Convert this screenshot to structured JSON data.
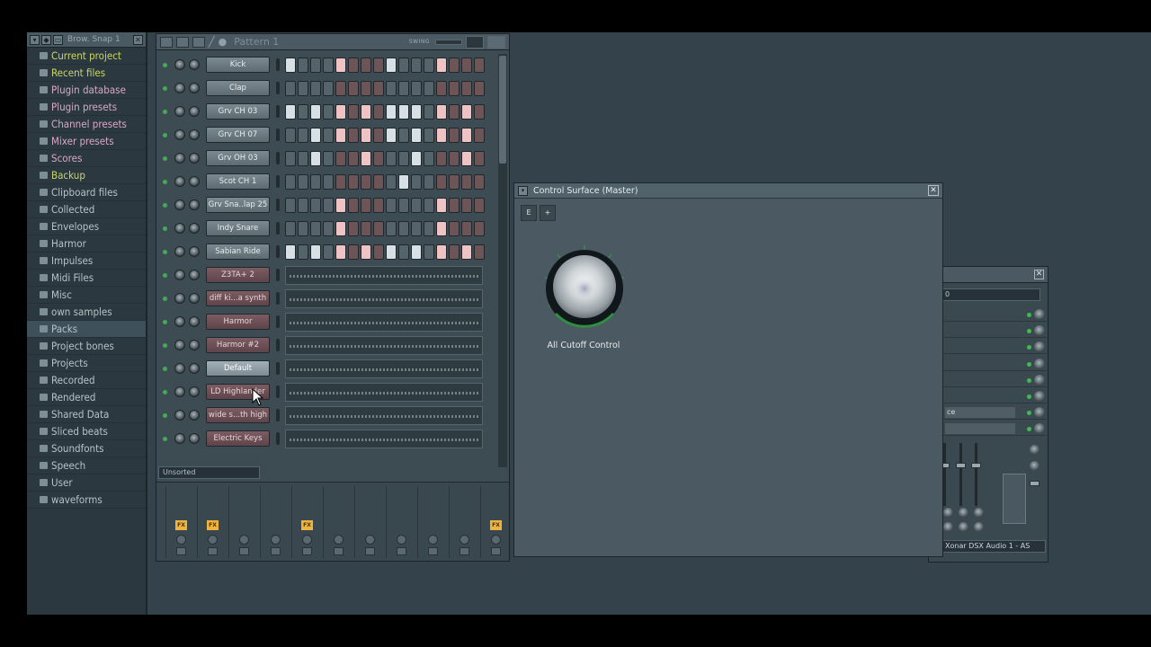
{
  "browser": {
    "title": "Brow. Snap 1",
    "items": [
      {
        "label": "Current project",
        "style": "hl",
        "icon": "project-icon"
      },
      {
        "label": "Recent files",
        "style": "hl",
        "icon": "recent-icon"
      },
      {
        "label": "Plugin database",
        "style": "pk",
        "icon": "plugin-icon"
      },
      {
        "label": "Plugin presets",
        "style": "pk",
        "icon": "plugin-icon"
      },
      {
        "label": "Channel presets",
        "style": "pk",
        "icon": "channel-icon"
      },
      {
        "label": "Mixer presets",
        "style": "pk",
        "icon": "mixer-icon"
      },
      {
        "label": "Scores",
        "style": "pk",
        "icon": "score-icon"
      },
      {
        "label": "Backup",
        "style": "hl",
        "icon": "folder-icon"
      },
      {
        "label": "Clipboard files",
        "style": "nm",
        "icon": "folder-icon"
      },
      {
        "label": "Collected",
        "style": "nm",
        "icon": "folder-icon"
      },
      {
        "label": "Envelopes",
        "style": "nm",
        "icon": "folder-icon"
      },
      {
        "label": "Harmor",
        "style": "nm",
        "icon": "folder-icon"
      },
      {
        "label": "Impulses",
        "style": "nm",
        "icon": "folder-icon"
      },
      {
        "label": "Midi Files",
        "style": "nm",
        "icon": "folder-icon"
      },
      {
        "label": "Misc",
        "style": "nm",
        "icon": "folder-icon"
      },
      {
        "label": "own samples",
        "style": "nm",
        "icon": "folder-icon"
      },
      {
        "label": "Packs",
        "style": "nm sel",
        "icon": "folder-icon"
      },
      {
        "label": "Project bones",
        "style": "nm",
        "icon": "folder-icon"
      },
      {
        "label": "Projects",
        "style": "nm",
        "icon": "folder-icon"
      },
      {
        "label": "Recorded",
        "style": "nm",
        "icon": "folder-icon"
      },
      {
        "label": "Rendered",
        "style": "nm",
        "icon": "folder-icon"
      },
      {
        "label": "Shared Data",
        "style": "nm",
        "icon": "folder-icon"
      },
      {
        "label": "Sliced beats",
        "style": "nm",
        "icon": "folder-icon"
      },
      {
        "label": "Soundfonts",
        "style": "nm",
        "icon": "folder-icon"
      },
      {
        "label": "Speech",
        "style": "nm",
        "icon": "folder-icon"
      },
      {
        "label": "User",
        "style": "nm",
        "icon": "user-icon"
      },
      {
        "label": "waveforms",
        "style": "nm",
        "icon": "folder-icon"
      }
    ]
  },
  "rack": {
    "pattern": "Pattern 1",
    "swing_label": "SWING",
    "filter": "Unsorted",
    "channels": [
      {
        "name": "Kick",
        "kind": "steps",
        "style": "samp",
        "steps": [
          1,
          0,
          0,
          0,
          1,
          0,
          0,
          0,
          1,
          0,
          0,
          0,
          1,
          0,
          0,
          0
        ]
      },
      {
        "name": "Clap",
        "kind": "steps",
        "style": "samp",
        "steps": [
          0,
          0,
          0,
          0,
          0,
          0,
          0,
          0,
          0,
          0,
          0,
          0,
          0,
          0,
          0,
          0
        ]
      },
      {
        "name": "Grv CH 03",
        "kind": "steps",
        "style": "samp",
        "steps": [
          1,
          0,
          1,
          0,
          1,
          0,
          1,
          0,
          1,
          1,
          1,
          0,
          1,
          0,
          1,
          0
        ]
      },
      {
        "name": "Grv CH 07",
        "kind": "steps",
        "style": "samp",
        "steps": [
          0,
          0,
          1,
          0,
          1,
          0,
          1,
          0,
          1,
          0,
          1,
          0,
          1,
          0,
          1,
          0
        ]
      },
      {
        "name": "Grv OH 03",
        "kind": "steps",
        "style": "samp",
        "steps": [
          0,
          0,
          1,
          0,
          0,
          0,
          1,
          0,
          0,
          0,
          1,
          0,
          0,
          0,
          1,
          0
        ]
      },
      {
        "name": "Scot CH 1",
        "kind": "steps",
        "style": "samp",
        "steps": [
          0,
          0,
          0,
          0,
          0,
          0,
          0,
          0,
          0,
          1,
          0,
          0,
          0,
          0,
          0,
          0
        ]
      },
      {
        "name": "Grv Sna..lap 25",
        "kind": "steps",
        "style": "samp",
        "steps": [
          0,
          0,
          0,
          0,
          1,
          0,
          0,
          0,
          0,
          0,
          0,
          0,
          1,
          0,
          0,
          0
        ]
      },
      {
        "name": "Indy Snare",
        "kind": "steps",
        "style": "samp",
        "steps": [
          0,
          0,
          0,
          0,
          1,
          0,
          0,
          0,
          0,
          0,
          0,
          0,
          1,
          0,
          0,
          0
        ]
      },
      {
        "name": "Sabian Ride",
        "kind": "steps",
        "style": "samp",
        "steps": [
          1,
          0,
          1,
          0,
          1,
          0,
          1,
          0,
          1,
          0,
          1,
          0,
          1,
          0,
          1,
          0
        ]
      },
      {
        "name": "Z3TA+ 2",
        "kind": "roll",
        "style": "synth"
      },
      {
        "name": "diff ki...a synth",
        "kind": "roll",
        "style": "synth"
      },
      {
        "name": "Harmor",
        "kind": "roll",
        "style": "synth"
      },
      {
        "name": "Harmor #2",
        "kind": "roll",
        "style": "synth"
      },
      {
        "name": "Default",
        "kind": "roll",
        "style": "sel"
      },
      {
        "name": "LD Highlander",
        "kind": "roll",
        "style": "synth"
      },
      {
        "name": "wide s...th high",
        "kind": "roll",
        "style": "synth"
      },
      {
        "name": "Electric Keys",
        "kind": "roll",
        "style": "synth"
      }
    ],
    "fx_label": "FX"
  },
  "control_surface": {
    "title": "Control Surface (Master)",
    "btn_e": "E",
    "btn_plus": "+",
    "knob_label": "All Cutoff Control"
  },
  "mixer": {
    "slot_partial": "ce",
    "device": "Xonar DSX Audio 1 - AS"
  },
  "colors": {
    "accent_green": "#41ac50",
    "browser_highlight": "#c9d66a",
    "browser_pink": "#d8a9c8",
    "fx_orange": "#f0b33d"
  }
}
